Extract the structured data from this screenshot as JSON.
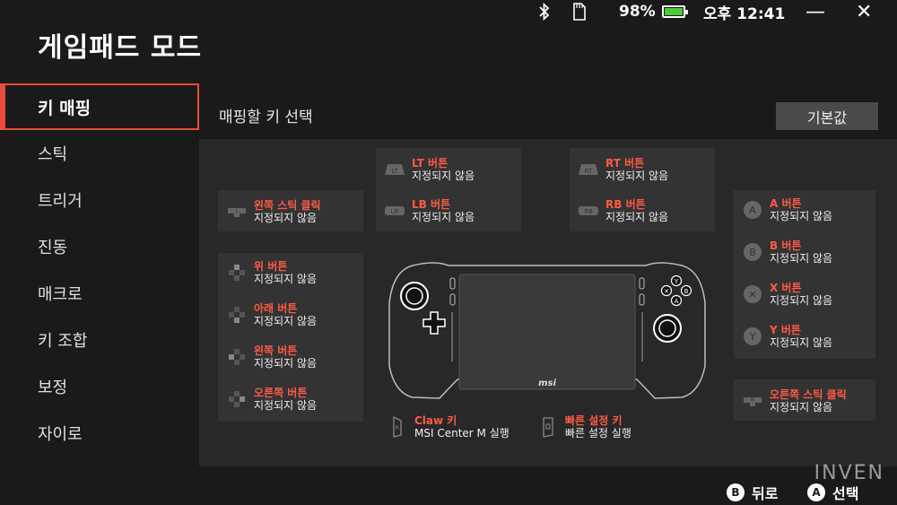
{
  "app": {
    "title": "게임패드 모드"
  },
  "status": {
    "battery_percent": "98%",
    "battery_level": 0.98,
    "time": "오후 12:41",
    "icons": [
      "bluetooth-icon",
      "sd-card-icon",
      "battery-icon"
    ],
    "minimize_label": "—",
    "close_label": "✕"
  },
  "sidebar": {
    "items": [
      {
        "label": "키 매핑",
        "active": true
      },
      {
        "label": "스틱"
      },
      {
        "label": "트리거"
      },
      {
        "label": "진동"
      },
      {
        "label": "매크로"
      },
      {
        "label": "키 조합"
      },
      {
        "label": "보정"
      },
      {
        "label": "자이로"
      }
    ]
  },
  "main": {
    "section_title": "매핑할 키 선택",
    "reset_label": "기본값",
    "unassigned": "지정되지 않음",
    "left_stick_click": {
      "label": "왼쪽 스틱 클릭",
      "value": "지정되지 않음"
    },
    "lt": {
      "label": "LT 버튼",
      "value": "지정되지 않음",
      "icon_text": "LT"
    },
    "lb": {
      "label": "LB 버튼",
      "value": "지정되지 않음",
      "icon_text": "LB"
    },
    "rt": {
      "label": "RT 버튼",
      "value": "지정되지 않음",
      "icon_text": "RT"
    },
    "rb": {
      "label": "RB 버튼",
      "value": "지정되지 않음",
      "icon_text": "RB"
    },
    "dpad": [
      {
        "label": "위 버튼",
        "value": "지정되지 않음"
      },
      {
        "label": "아래 버튼",
        "value": "지정되지 않음"
      },
      {
        "label": "왼쪽 버튼",
        "value": "지정되지 않음"
      },
      {
        "label": "오른쪽 버튼",
        "value": "지정되지 않음"
      }
    ],
    "face": [
      {
        "label": "A 버튼",
        "value": "지정되지 않음",
        "icon_text": "A"
      },
      {
        "label": "B 버튼",
        "value": "지정되지 않음",
        "icon_text": "B"
      },
      {
        "label": "X 버튼",
        "value": "지정되지 않음",
        "icon_text": "✕"
      },
      {
        "label": "Y 버튼",
        "value": "지정되지 않음",
        "icon_text": "Y"
      }
    ],
    "right_stick_click": {
      "label": "오른쪽 스틱 클릭",
      "value": "지정되지 않음"
    },
    "claw": {
      "label": "Claw 키",
      "value": "MSI Center M 실행"
    },
    "quick_settings": {
      "label": "빠른 설정 키",
      "value": "빠른 설정 실행"
    },
    "device_brand": "msi",
    "face_glyphs": [
      "Y",
      "✕",
      "B",
      "A"
    ]
  },
  "footer": {
    "back": {
      "button": "B",
      "label": "뒤로"
    },
    "select": {
      "button": "A",
      "label": "선택"
    },
    "watermark": "INVEN"
  },
  "colors": {
    "accent": "#e84b3c",
    "label_red": "#ff5a45",
    "battery_green": "#4ccb3a"
  }
}
